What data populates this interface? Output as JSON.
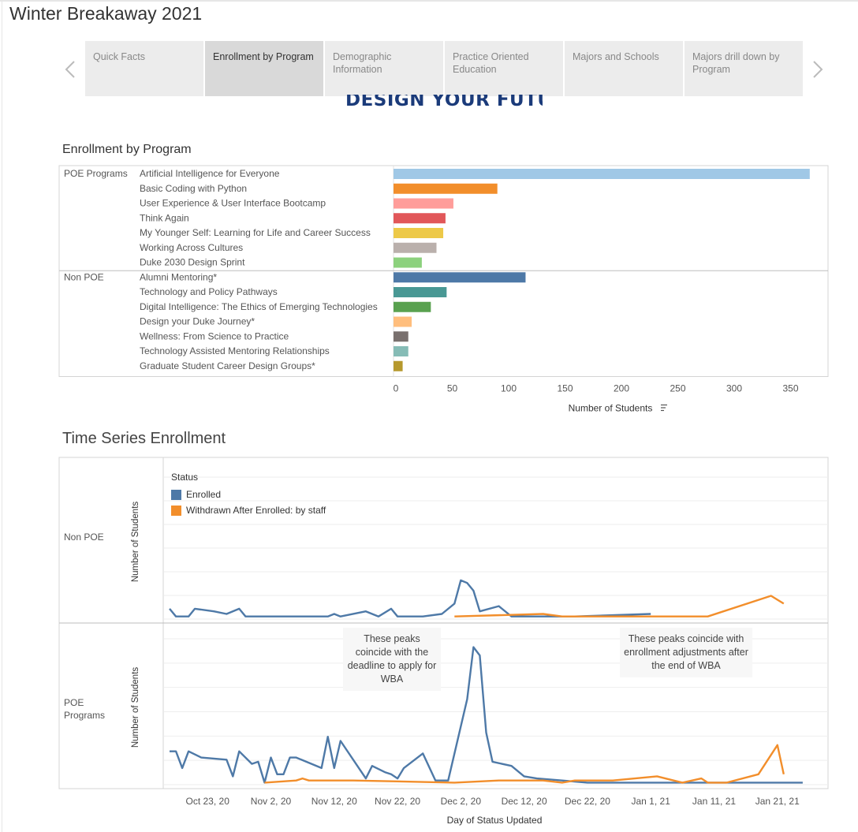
{
  "dashboard": {
    "title": "Winter Breakaway 2021"
  },
  "nav": {
    "prev_icon": "chevron-left-icon",
    "next_icon": "chevron-right-icon",
    "tabs": [
      {
        "label": "Quick Facts",
        "active": false
      },
      {
        "label": "Enrollment by Program",
        "active": true
      },
      {
        "label": "Demographic Information",
        "active": false
      },
      {
        "label": "Practice Oriented Education",
        "active": false
      },
      {
        "label": "Majors and Schools",
        "active": false
      },
      {
        "label": "Majors drill down by Program",
        "active": false
      }
    ]
  },
  "banner": {
    "text": "DESIGN YOUR FUTURE",
    "color": "#1b3b7a"
  },
  "enrollment_chart": {
    "section_title": "Enrollment by Program"
  },
  "timeseries_chart": {
    "section_title": "Time Series Enrollment"
  },
  "annotations": {
    "left": "These peaks coincide with the deadline to apply for WBA",
    "right": "These peaks coincide with enrollment adjustments after the end of WBA"
  },
  "chart_data": [
    {
      "type": "bar",
      "orientation": "horizontal",
      "title": "Enrollment by Program",
      "xlabel": "Number of Students",
      "xlim": [
        0,
        370
      ],
      "xticks": [
        0,
        50,
        100,
        150,
        200,
        250,
        300,
        350
      ],
      "groups": [
        {
          "name": "POE Programs",
          "categories": [
            "Artificial Intelligence for Everyone",
            "Basic Coding with Python",
            "User Experience & User Interface Bootcamp",
            "Think Again",
            "My Younger Self: Learning for Life and Career Success",
            "Working Across Cultures",
            "Duke 2030 Design Sprint"
          ],
          "values": [
            367,
            90,
            51,
            44,
            42,
            36,
            23
          ],
          "colors": [
            "#a0c8e6",
            "#f28e2b",
            "#ff9d9a",
            "#e15759",
            "#edc948",
            "#bab0ac",
            "#8cd17d"
          ]
        },
        {
          "name": "Non POE",
          "categories": [
            "Alumni Mentoring*",
            "Technology and Policy Pathways",
            "Digital Intelligence: The Ethics of Emerging Technologies",
            "Design your Duke Journey*",
            "Wellness: From Science to Practice",
            "Technology Assisted Mentoring Relationships",
            "Graduate Student Career Design Groups*"
          ],
          "values": [
            115,
            45,
            31,
            14,
            11,
            11,
            6
          ],
          "colors": [
            "#4e79a7",
            "#499894",
            "#59a14f",
            "#ffbe7d",
            "#79706e",
            "#86bcb6",
            "#b6992d"
          ]
        }
      ]
    },
    {
      "type": "line",
      "xlabel": "Day of Status Updated",
      "ylabel": "Number of Students",
      "legend_title": "Status",
      "xticks": [
        "Oct 23, 20",
        "Nov 2, 20",
        "Nov 12, 20",
        "Nov 22, 20",
        "Dec 2, 20",
        "Dec 12, 20",
        "Dec 22, 20",
        "Jan 1, 21",
        "Jan 11, 21",
        "Jan 21, 21"
      ],
      "xlim": [
        "2020-10-16",
        "2021-01-29"
      ],
      "series_colors": {
        "Enrolled": "#4e79a7",
        "Withdrawn After Enrolled: by staff": "#f28e2b"
      },
      "panels": [
        {
          "name": "Non POE",
          "ylim": [
            0,
            55
          ],
          "series": [
            {
              "name": "Enrolled",
              "points": [
                [
                  "2020-10-17",
                  4
                ],
                [
                  "2020-10-18",
                  1
                ],
                [
                  "2020-10-20",
                  1
                ],
                [
                  "2020-10-21",
                  4
                ],
                [
                  "2020-10-24",
                  3
                ],
                [
                  "2020-10-26",
                  2
                ],
                [
                  "2020-10-28",
                  4
                ],
                [
                  "2020-10-29",
                  1
                ],
                [
                  "2020-11-02",
                  1
                ],
                [
                  "2020-11-05",
                  1
                ],
                [
                  "2020-11-08",
                  1
                ],
                [
                  "2020-11-11",
                  1
                ],
                [
                  "2020-11-12",
                  2
                ],
                [
                  "2020-11-13",
                  1
                ],
                [
                  "2020-11-17",
                  3
                ],
                [
                  "2020-11-19",
                  1
                ],
                [
                  "2020-11-21",
                  4
                ],
                [
                  "2020-11-22",
                  1
                ],
                [
                  "2020-11-26",
                  1
                ],
                [
                  "2020-11-29",
                  2
                ],
                [
                  "2020-12-01",
                  6
                ],
                [
                  "2020-12-02",
                  15
                ],
                [
                  "2020-12-03",
                  14
                ],
                [
                  "2020-12-04",
                  11
                ],
                [
                  "2020-12-05",
                  3
                ],
                [
                  "2020-12-08",
                  5
                ],
                [
                  "2020-12-10",
                  1
                ],
                [
                  "2020-12-20",
                  1
                ],
                [
                  "2021-01-01",
                  2
                ]
              ]
            },
            {
              "name": "Withdrawn After Enrolled: by staff",
              "points": [
                [
                  "2020-12-01",
                  1
                ],
                [
                  "2020-12-15",
                  2
                ],
                [
                  "2020-12-18",
                  1
                ],
                [
                  "2020-12-20",
                  1
                ],
                [
                  "2021-01-10",
                  1
                ],
                [
                  "2021-01-20",
                  9
                ],
                [
                  "2021-01-22",
                  6
                ]
              ]
            }
          ]
        },
        {
          "name": "POE Programs",
          "ylim": [
            0,
            70
          ],
          "series": [
            {
              "name": "Enrolled",
              "points": [
                [
                  "2020-10-17",
                  16
                ],
                [
                  "2020-10-18",
                  16
                ],
                [
                  "2020-10-19",
                  8
                ],
                [
                  "2020-10-20",
                  16
                ],
                [
                  "2020-10-22",
                  13
                ],
                [
                  "2020-10-26",
                  12
                ],
                [
                  "2020-10-27",
                  4
                ],
                [
                  "2020-10-28",
                  16
                ],
                [
                  "2020-10-30",
                  10
                ],
                [
                  "2020-10-31",
                  11
                ],
                [
                  "2020-11-01",
                  1
                ],
                [
                  "2020-11-02",
                  13
                ],
                [
                  "2020-11-03",
                  5
                ],
                [
                  "2020-11-04",
                  5
                ],
                [
                  "2020-11-05",
                  13
                ],
                [
                  "2020-11-06",
                  13
                ],
                [
                  "2020-11-10",
                  8
                ],
                [
                  "2020-11-11",
                  23
                ],
                [
                  "2020-11-12",
                  8
                ],
                [
                  "2020-11-13",
                  21
                ],
                [
                  "2020-11-17",
                  3
                ],
                [
                  "2020-11-18",
                  9
                ],
                [
                  "2020-11-20",
                  6
                ],
                [
                  "2020-11-21",
                  5
                ],
                [
                  "2020-11-22",
                  3
                ],
                [
                  "2020-11-23",
                  8
                ],
                [
                  "2020-11-26",
                  15
                ],
                [
                  "2020-11-28",
                  2
                ],
                [
                  "2020-11-30",
                  2
                ],
                [
                  "2020-12-03",
                  41
                ],
                [
                  "2020-12-04",
                  66
                ],
                [
                  "2020-12-05",
                  62
                ],
                [
                  "2020-12-06",
                  25
                ],
                [
                  "2020-12-07",
                  11
                ],
                [
                  "2020-12-10",
                  9
                ],
                [
                  "2020-12-12",
                  4
                ],
                [
                  "2020-12-14",
                  3
                ],
                [
                  "2020-12-18",
                  2
                ],
                [
                  "2020-12-22",
                  1
                ],
                [
                  "2020-12-30",
                  1
                ],
                [
                  "2021-01-11",
                  1
                ],
                [
                  "2021-01-21",
                  1
                ],
                [
                  "2021-01-25",
                  1
                ]
              ]
            },
            {
              "name": "Withdrawn After Enrolled: by staff",
              "points": [
                [
                  "2020-11-01",
                  1
                ],
                [
                  "2020-11-06",
                  2
                ],
                [
                  "2020-11-07",
                  3
                ],
                [
                  "2020-11-08",
                  2
                ],
                [
                  "2020-11-15",
                  2
                ],
                [
                  "2020-12-01",
                  1
                ],
                [
                  "2020-12-08",
                  2
                ],
                [
                  "2020-12-15",
                  2
                ],
                [
                  "2020-12-18",
                  1
                ],
                [
                  "2020-12-20",
                  2
                ],
                [
                  "2020-12-26",
                  2
                ],
                [
                  "2021-01-02",
                  4
                ],
                [
                  "2021-01-06",
                  1
                ],
                [
                  "2021-01-09",
                  3
                ],
                [
                  "2021-01-10",
                  1
                ],
                [
                  "2021-01-13",
                  1
                ],
                [
                  "2021-01-18",
                  5
                ],
                [
                  "2021-01-21",
                  19
                ],
                [
                  "2021-01-22",
                  5
                ]
              ]
            }
          ]
        }
      ]
    }
  ]
}
